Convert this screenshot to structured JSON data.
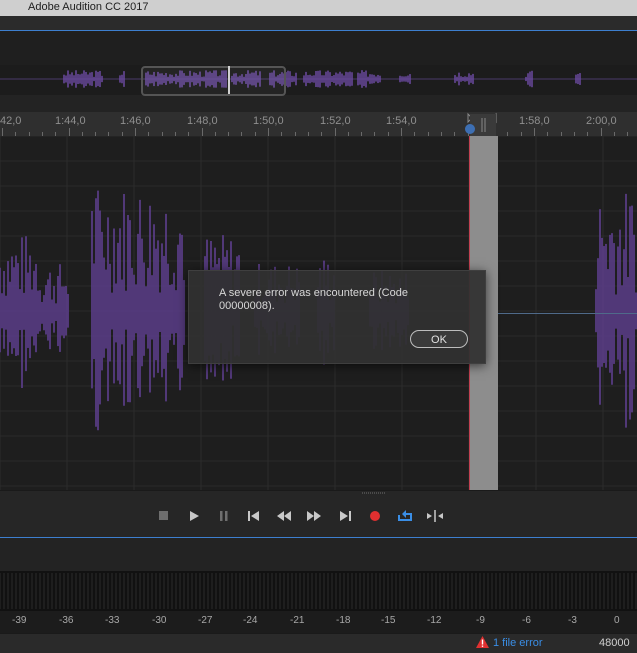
{
  "app": {
    "title": "Adobe Audition CC 2017"
  },
  "ruler": {
    "labels": [
      "42,0",
      "1:44,0",
      "1:46,0",
      "1:48,0",
      "1:50,0",
      "1:52,0",
      "1:54,0",
      "1:58,0",
      "2:00,0"
    ]
  },
  "dialog": {
    "message": "A severe error was encountered (Code 00000008).",
    "ok_label": "OK"
  },
  "transport": {
    "buttons": [
      "stop",
      "play",
      "pause",
      "go-to-start",
      "rewind",
      "fast-forward",
      "go-to-end",
      "record",
      "loop",
      "skip-selection"
    ]
  },
  "levels": {
    "scale": [
      "-39",
      "-36",
      "-33",
      "-30",
      "-27",
      "-24",
      "-21",
      "-18",
      "-15",
      "-12",
      "-9",
      "-6",
      "-3",
      "0"
    ]
  },
  "status": {
    "error_text": "1 file error",
    "sample_rate": "48000"
  },
  "colors": {
    "accent": "#3d7fcf",
    "waveform": "#5e3f8f",
    "record": "#e03030",
    "error": "#e03030",
    "link": "#3a8ee6"
  }
}
